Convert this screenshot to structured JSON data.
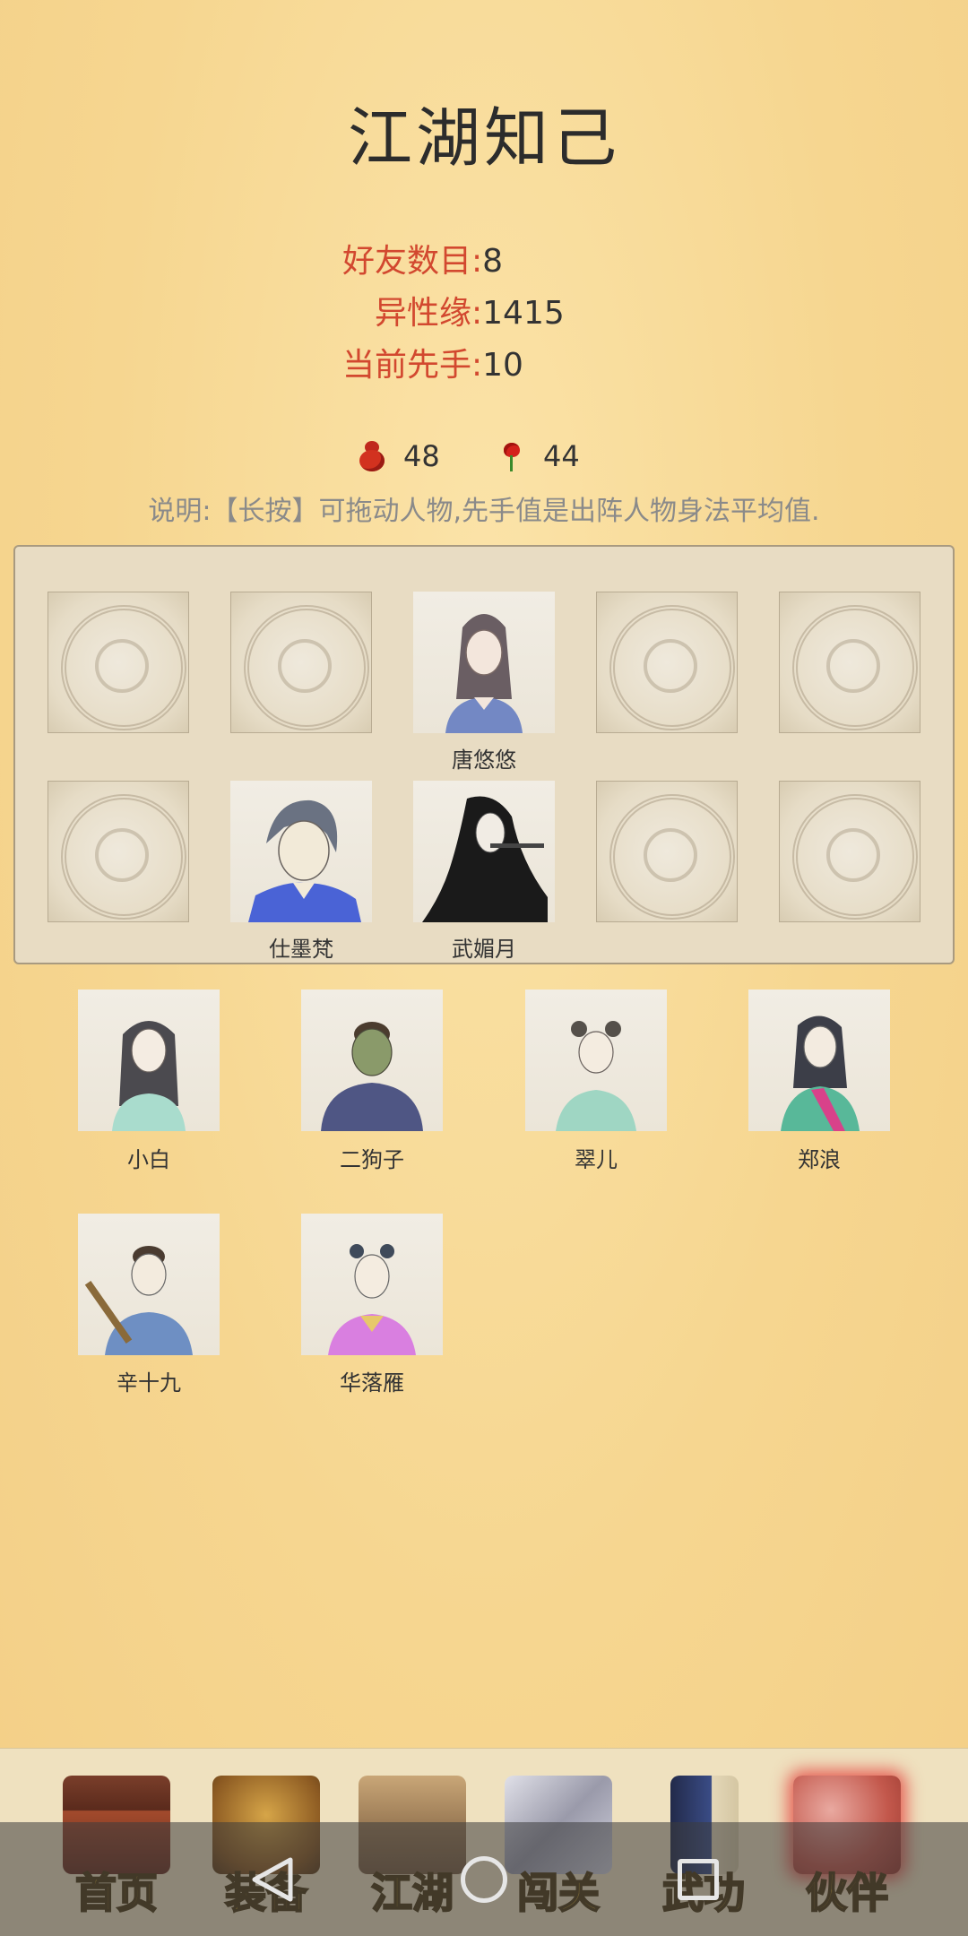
{
  "page_title": "江湖知己",
  "stats": [
    {
      "label": "好友数目:",
      "value": "8"
    },
    {
      "label": "异性缘:",
      "value": "1415"
    },
    {
      "label": "当前先手:",
      "value": "10"
    }
  ],
  "currency": {
    "gourd_count": "48",
    "rose_count": "44"
  },
  "instructions": "说明:【长按】可拖动人物,先手值是出阵人物身法平均值.",
  "formation": {
    "row1": [
      {
        "name": ""
      },
      {
        "name": ""
      },
      {
        "name": "唐悠悠"
      },
      {
        "name": ""
      },
      {
        "name": ""
      }
    ],
    "row2": [
      {
        "name": ""
      },
      {
        "name": "仕墨梵"
      },
      {
        "name": "武媚月"
      },
      {
        "name": ""
      },
      {
        "name": ""
      }
    ]
  },
  "companions": [
    {
      "name": "小白"
    },
    {
      "name": "二狗子"
    },
    {
      "name": "翠儿"
    },
    {
      "name": "郑浪"
    },
    {
      "name": "辛十九"
    },
    {
      "name": "华落雁"
    }
  ],
  "nav": [
    {
      "label": "首页",
      "icon": "house-icon"
    },
    {
      "label": "装备",
      "icon": "armor-icon"
    },
    {
      "label": "江湖",
      "icon": "scroll-icon"
    },
    {
      "label": "闯关",
      "icon": "swords-icon"
    },
    {
      "label": "武功",
      "icon": "book-icon"
    },
    {
      "label": "伙伴",
      "icon": "companions-icon",
      "active": true
    }
  ],
  "colors": {
    "background": "#f6d690",
    "stat_label": "#d2482f",
    "nav_label": "#c8a02a",
    "active_glow": "#e12828"
  }
}
